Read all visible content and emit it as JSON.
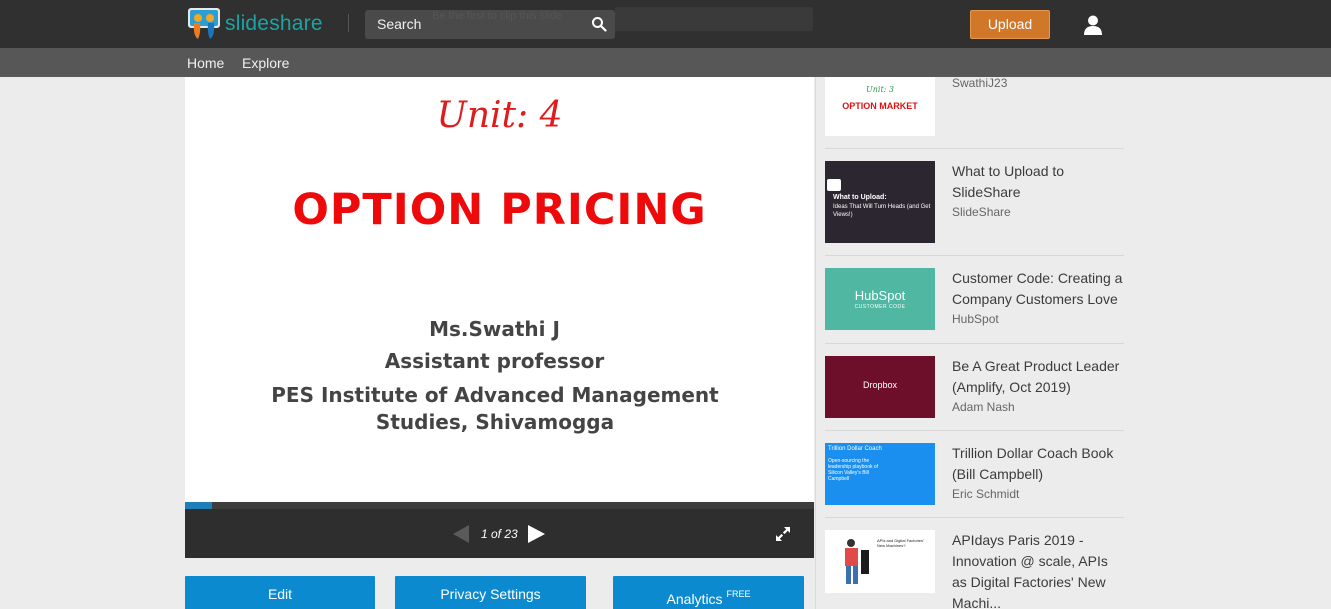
{
  "header": {
    "logo_text": "slideshare",
    "search_label": "Search",
    "ghost_text": "Be the first to clip this slide",
    "upload_label": "Upload"
  },
  "nav": {
    "home": "Home",
    "explore": "Explore"
  },
  "slide": {
    "unit": "Unit: 4",
    "title": "OPTION PRICING",
    "author": "Ms.Swathi J",
    "role": "Assistant professor",
    "institute": "PES Institute of Advanced Management Studies, Shivamogga"
  },
  "player": {
    "page_info": "1 of 23",
    "progress_fraction": 0.043
  },
  "actions": {
    "edit": "Edit",
    "privacy": "Privacy Settings",
    "analytics": "Analytics",
    "analytics_badge": "FREE"
  },
  "related": [
    {
      "title": "",
      "author": "SwathiJ23",
      "thumb_text_1": "Unit: 3",
      "thumb_text_2": "OPTION MARKET"
    },
    {
      "title": "What to Upload to SlideShare",
      "author": "SlideShare",
      "thumb_text_1": "What to Upload:",
      "thumb_text_2": "Ideas That Will Turn Heads (and Get Views!)"
    },
    {
      "title": "Customer Code: Creating a Company Customers Love",
      "author": "HubSpot",
      "thumb_text_1": "HubSpot",
      "thumb_text_2": "CUSTOMER CODE"
    },
    {
      "title": "Be A Great Product Leader (Amplify, Oct 2019)",
      "author": "Adam Nash",
      "thumb_text_1": "Dropbox"
    },
    {
      "title": "Trillion Dollar Coach Book (Bill Campbell)",
      "author": "Eric Schmidt",
      "thumb_text_1": "Trillion Dollar Coach",
      "thumb_text_2": "Open-sourcing the leadership playbook of Silicon Valley's Bill Campbell"
    },
    {
      "title": "APIdays Paris 2019 - Innovation @ scale, APIs as Digital Factories' New Machi...",
      "author": "",
      "thumb_text_1": "APIs and Digital Factories' New Machines?"
    }
  ],
  "colors": {
    "topbar": "#303030",
    "navbar": "#575757",
    "brand": "#19a5a5",
    "upload": "#d1772a",
    "action_blue": "#0c8ad0",
    "slide_red": "#ee0a0a"
  }
}
